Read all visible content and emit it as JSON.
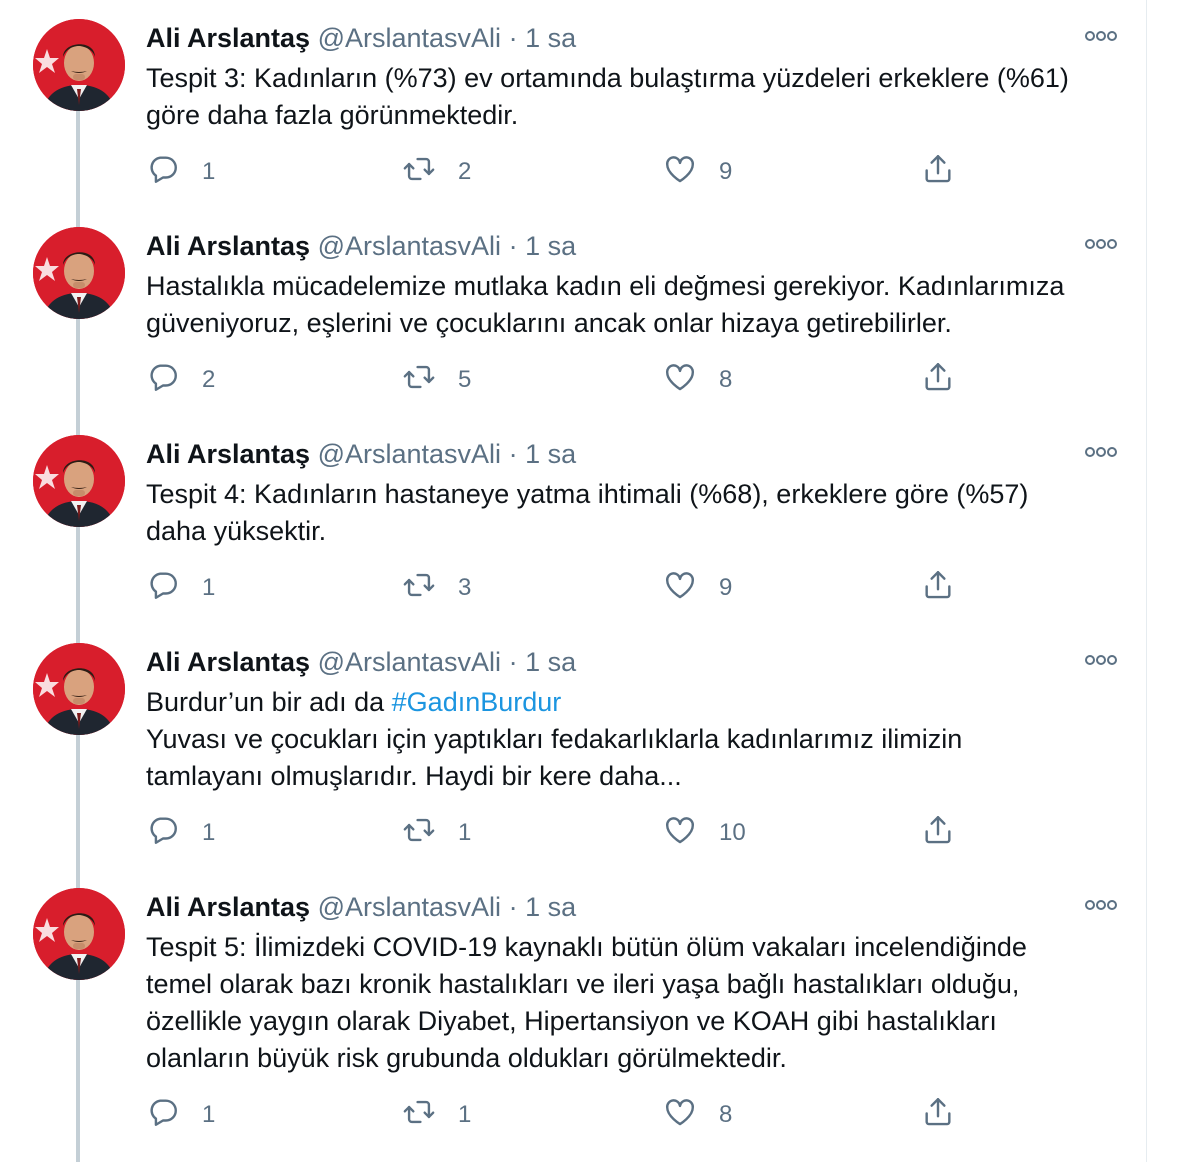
{
  "tweets": [
    {
      "name": "Ali Arslantaş",
      "handle": "@ArslantasvAli",
      "separator": "·",
      "time": "1 sa",
      "lines": [
        "Tespit 3: Kadınların (%73) ev ortamında bulaştırma yüzdeleri erkeklere (%61)",
        "göre daha fazla görünmektedir."
      ],
      "replies": "1",
      "retweets": "2",
      "likes": "9"
    },
    {
      "name": "Ali Arslantaş",
      "handle": "@ArslantasvAli",
      "separator": "·",
      "time": "1 sa",
      "lines": [
        "Hastalıkla mücadelemize mutlaka kadın eli değmesi gerekiyor. Kadınlarımıza",
        "güveniyoruz, eşlerini ve çocuklarını ancak onlar hizaya getirebilirler."
      ],
      "replies": "2",
      "retweets": "5",
      "likes": "8"
    },
    {
      "name": "Ali Arslantaş",
      "handle": "@ArslantasvAli",
      "separator": "·",
      "time": "1 sa",
      "lines": [
        "Tespit 4: Kadınların hastaneye yatma ihtimali (%68), erkeklere göre (%57)",
        "daha yüksektir."
      ],
      "replies": "1",
      "retweets": "3",
      "likes": "9"
    },
    {
      "name": "Ali Arslantaş",
      "handle": "@ArslantasvAli",
      "separator": "·",
      "time": "1 sa",
      "line1_prefix": "Burdur’un bir adı da ",
      "hashtag": "#GadınBurdur",
      "lines": [
        "Yuvası ve çocukları için yaptıkları fedakarlıklarla kadınlarımız ilimizin",
        "tamlayanı olmuşlarıdır. Haydi bir kere daha..."
      ],
      "replies": "1",
      "retweets": "1",
      "likes": "10"
    },
    {
      "name": "Ali Arslantaş",
      "handle": "@ArslantasvAli",
      "separator": "·",
      "time": "1 sa",
      "lines": [
        "Tespit 5: İlimizdeki COVID-19 kaynaklı bütün ölüm vakaları incelendiğinde",
        "temel olarak bazı kronik hastalıkları ve ileri yaşa bağlı hastalıkları olduğu,",
        "özellikle yaygın olarak Diyabet, Hipertansiyon ve KOAH gibi hastalıkları",
        "olanların büyük risk grubunda oldukları görülmektedir."
      ],
      "replies": "1",
      "retweets": "1",
      "likes": "8"
    }
  ],
  "colors": {
    "text": "#0f1419",
    "secondary": "#5b7083",
    "link": "#1b95e0",
    "thread_line": "#c4cfd6",
    "avatar_red": "#d81e2c"
  },
  "icons": [
    "avatar",
    "more-icon",
    "reply-icon",
    "retweet-icon",
    "like-icon",
    "share-icon"
  ]
}
